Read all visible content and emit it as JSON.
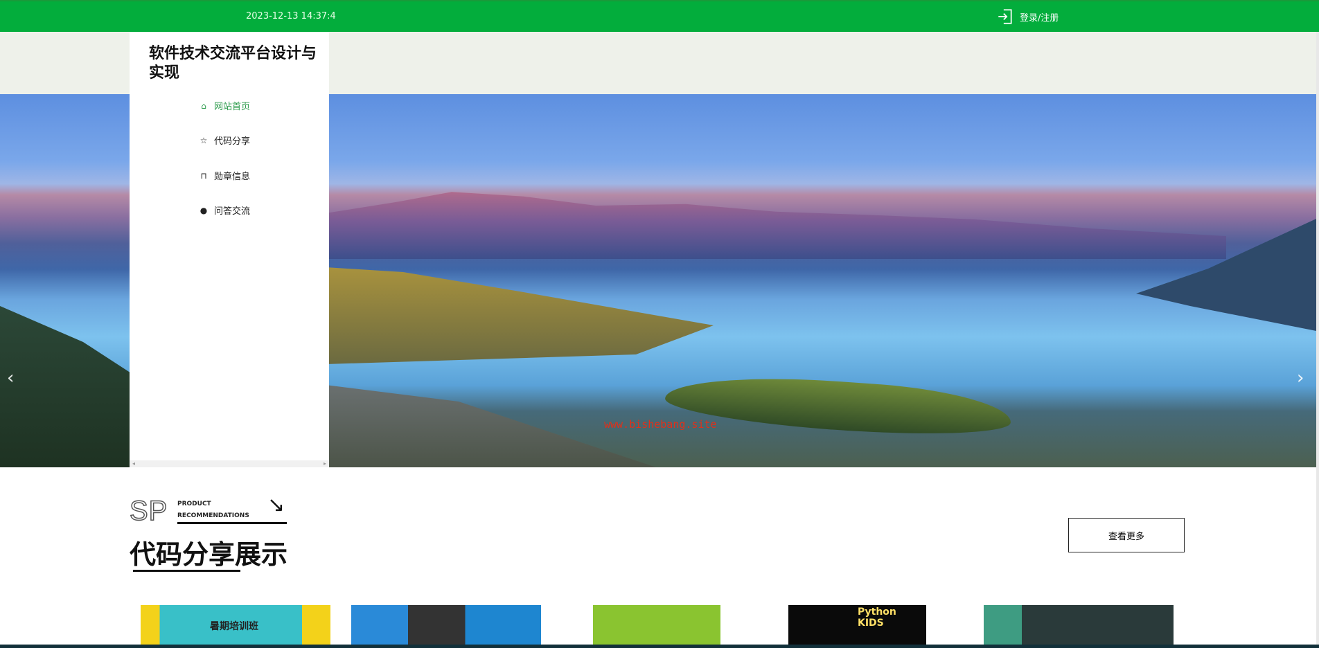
{
  "topbar": {
    "datetime": "2023-12-13 14:37:4",
    "login_label": "登录/注册",
    "login_icon": "sign-in-icon",
    "color": "#03ad3c"
  },
  "sidebar": {
    "title": "软件技术交流平台设计与实现",
    "items": [
      {
        "label": "网站首页",
        "icon": "home-icon",
        "active": true
      },
      {
        "label": "代码分享",
        "icon": "star-icon"
      },
      {
        "label": "勋章信息",
        "icon": "bag-icon"
      },
      {
        "label": "问答交流",
        "icon": "info-circle-icon"
      }
    ]
  },
  "banner": {
    "watermark": "www.bishebang.site",
    "prev_icon": "chevron-left-icon",
    "next_icon": "chevron-right-icon"
  },
  "section": {
    "logo": "SP",
    "sub1": "PRODUCT",
    "sub2": "RECOMMENDATIONS",
    "title": "代码分享展示",
    "more_label": "查看更多"
  },
  "cards": [
    {
      "caption": "暑期培训班"
    },
    {
      "caption": ""
    },
    {
      "caption": ""
    },
    {
      "caption": "Python KIDS"
    },
    {
      "caption": ""
    }
  ]
}
